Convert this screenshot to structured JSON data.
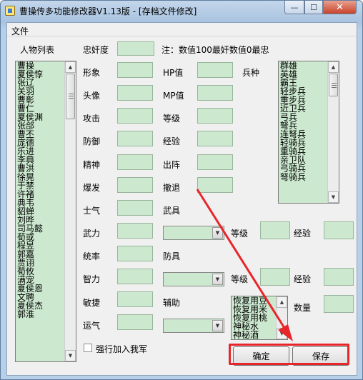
{
  "window": {
    "title": "曹操传多功能修改器V1.13版 - [存档文件修改]",
    "min_glyph": "—",
    "max_glyph": "☐",
    "close_glyph": "✕"
  },
  "menu": {
    "file": "文件"
  },
  "hero_list": {
    "label": "人物列表",
    "items": [
      "曹操",
      "夏侯惇",
      "张辽",
      "关羽",
      "曹彰",
      "曹仁",
      "夏侯渊",
      "张郃",
      "曹丕",
      "庞德",
      "乐进",
      "李典",
      "曹洪",
      "徐晃",
      "于禁",
      "许褚",
      "典韦",
      "貂蝉",
      "刘晔",
      "司马懿",
      "荀或",
      "程昱",
      "郭嘉",
      "贾诩",
      "荀攸",
      "满宠",
      "夏侯恩",
      "文聘",
      "夏侯杰",
      "郭淮"
    ]
  },
  "fields": {
    "loyalty": "忠奸度",
    "loyalty_note": "注：数值100最奸数值0最忠",
    "portrait_form": "形象",
    "portrait_head": "头像",
    "attack": "攻击",
    "defense": "防御",
    "spirit": "精神",
    "burst": "爆发",
    "morale": "士气",
    "force": "武力",
    "command": "统率",
    "intelligence": "智力",
    "agility": "敏捷",
    "luck": "运气",
    "hp": "HP值",
    "mp": "MP值",
    "level": "等级",
    "exp": "经验",
    "sortie": "出阵",
    "retreat": "撤退",
    "weapon": "武具",
    "armor": "防具",
    "assist": "辅助",
    "troop": "兵种",
    "weapon_level": "等级",
    "weapon_exp": "经验",
    "armor_level": "等级",
    "armor_exp": "经验",
    "quantity": "数量"
  },
  "troops": {
    "items": [
      "群雄",
      "英雄",
      "霸王",
      "轻步兵",
      "重步兵",
      "近卫兵",
      "弓兵",
      "弩兵",
      "连弩兵",
      "轻骑兵",
      "重骑兵",
      "亲卫队",
      "弓骑兵",
      "弩骑兵"
    ]
  },
  "items": {
    "list": [
      "恢复用豆",
      "恢复用米",
      "恢复用桃",
      "神秘水",
      "神秘酒"
    ]
  },
  "checkbox": {
    "label": "强行加入我军"
  },
  "buttons": {
    "ok": "确定",
    "save": "保存"
  },
  "scroll": {
    "up": "▲",
    "down": "▼"
  },
  "combo": {
    "arrow": "▼"
  },
  "annotation": {
    "color": "#e8262a"
  }
}
